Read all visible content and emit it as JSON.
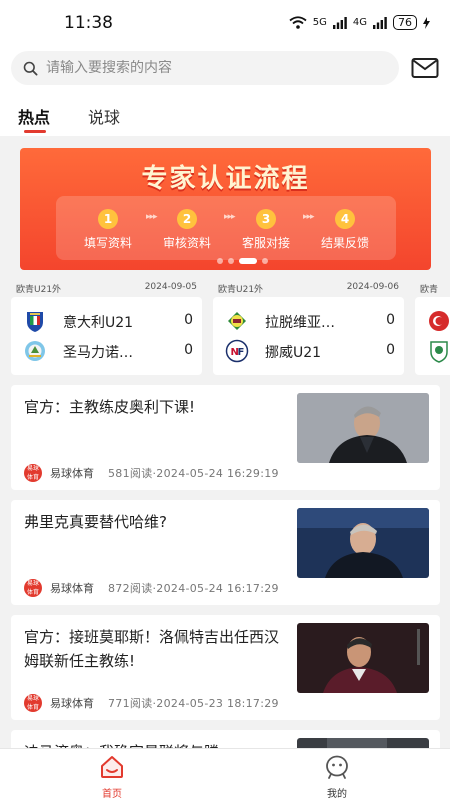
{
  "status_bar": {
    "time": "11:38",
    "network_1": "5G",
    "network_2": "4G",
    "battery": "76",
    "icons": [
      "wifi-icon",
      "signal-icon",
      "signal-icon",
      "battery-icon",
      "charging-icon"
    ]
  },
  "search": {
    "placeholder": "请输入要搜索的内容",
    "icon": "search-icon"
  },
  "header": {
    "message_icon": "mail-icon"
  },
  "tabs": [
    {
      "label": "热点",
      "active": true
    },
    {
      "label": "说球",
      "active": false
    }
  ],
  "banner": {
    "title": "专家认证流程",
    "steps": [
      {
        "num": "1",
        "label": "填写资料"
      },
      {
        "num": "2",
        "label": "审核资料"
      },
      {
        "num": "3",
        "label": "客服对接"
      },
      {
        "num": "4",
        "label": "结果反馈"
      }
    ],
    "page_count": 4,
    "active_page": 3
  },
  "matches": [
    {
      "league": "欧青U21外",
      "date": "2024-09-05",
      "home": {
        "name": "意大利U21",
        "score": "0",
        "badge": "italy-crest-icon"
      },
      "away": {
        "name": "圣马力诺…",
        "score": "0",
        "badge": "san-marino-crest-icon"
      }
    },
    {
      "league": "欧青U21外",
      "date": "2024-09-06",
      "home": {
        "name": "拉脱维亚…",
        "score": "0",
        "badge": "latvia-crest-icon"
      },
      "away": {
        "name": "挪威U21",
        "score": "0",
        "badge": "norway-crest-icon"
      }
    },
    {
      "league": "欧青",
      "date": "",
      "home": {
        "name": "",
        "score": "",
        "badge": "turkey-crest-icon"
      },
      "away": {
        "name": "",
        "score": "",
        "badge": "ireland-crest-icon"
      }
    }
  ],
  "news": [
    {
      "title": "官方：主教练皮奥利下课!",
      "source": "易球体育",
      "reads": "581阅读",
      "time": "2024-05-24 16:29:19",
      "thumb": "coach-photo-1"
    },
    {
      "title": "弗里克真要替代哈维?",
      "source": "易球体育",
      "reads": "872阅读",
      "time": "2024-05-24 16:17:29",
      "thumb": "coach-photo-2"
    },
    {
      "title": "官方：接班莫耶斯！洛佩特吉出任西汉姆联新任主教练!",
      "source": "易球体育",
      "reads": "771阅读",
      "time": "2024-05-23 18:17:29",
      "thumb": "coach-photo-3"
    },
    {
      "title": "迪马济奥：我确定曼联将与滕",
      "source": "",
      "reads": "",
      "time": "",
      "thumb": "coach-photo-4"
    }
  ],
  "source_logo_text": "易球体育",
  "bottom_nav": [
    {
      "label": "首页",
      "icon": "home-icon",
      "active": true
    },
    {
      "label": "我的",
      "icon": "profile-icon",
      "active": false
    }
  ],
  "colors": {
    "accent": "#e23a2e",
    "banner": "#f4452d",
    "step_badge": "#ffc23d"
  }
}
